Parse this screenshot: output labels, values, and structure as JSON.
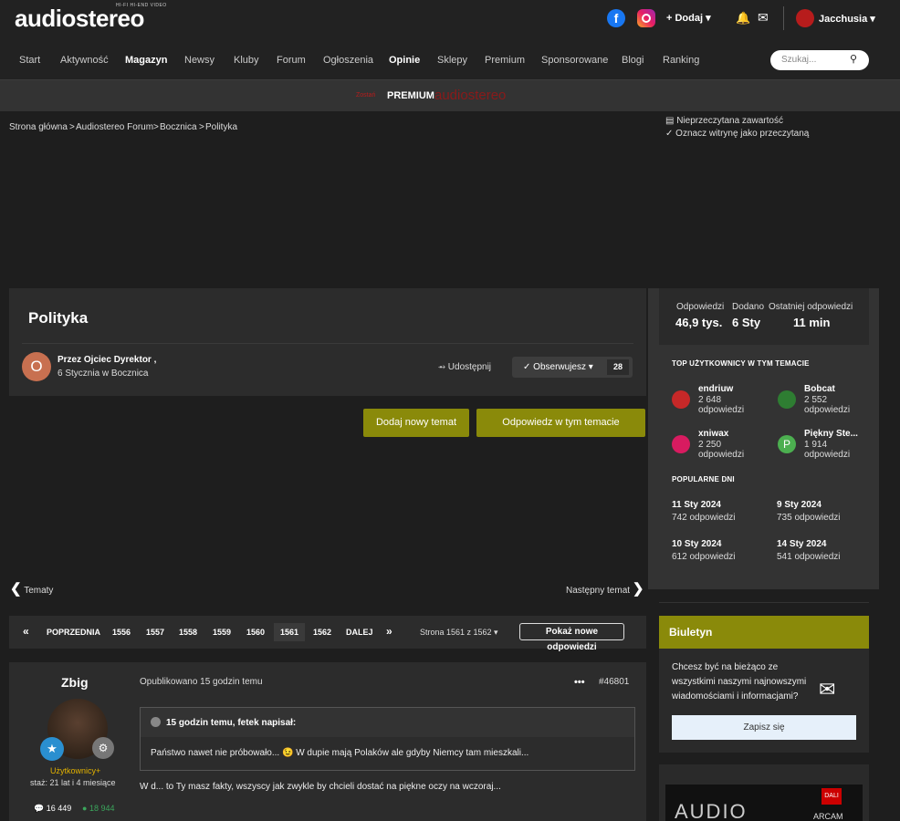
{
  "header": {
    "logo": "audiostereo",
    "logo_sub": "HI-FI   HI-END   VIDEO",
    "add_label": "+ Dodaj ▾",
    "user_name": "Jacchusia ▾"
  },
  "nav": [
    {
      "label": "Start"
    },
    {
      "label": "Aktywność"
    },
    {
      "label": "Magazyn"
    },
    {
      "label": "Newsy"
    },
    {
      "label": "Kluby"
    },
    {
      "label": "Forum"
    },
    {
      "label": "Ogłoszenia"
    },
    {
      "label": "Opinie"
    },
    {
      "label": "Sklepy"
    },
    {
      "label": "Premium"
    },
    {
      "label": "Sponsorowane"
    },
    {
      "label": "Blogi"
    },
    {
      "label": "Ranking"
    }
  ],
  "search": {
    "placeholder": "Szukaj..."
  },
  "strip": {
    "t1": "Zostań",
    "t2": "PREMIUM",
    "t3": "audiostereo"
  },
  "breadcrumb": [
    "Strona główna",
    "Audiostereo Forum",
    "Bocznica",
    "Polityka"
  ],
  "unread": "Nieprzeczytana zawartość",
  "markread": "Oznacz witrynę jako przeczytaną",
  "topic": {
    "title": "Polityka",
    "author_initial": "O",
    "by": "Przez Ojciec Dyrektor ,",
    "date": "6 Stycznia w Bocznica",
    "share": "Udostępnij",
    "follow": "Obserwujesz ▾",
    "follow_count": "28",
    "new_topic": "Dodaj nowy temat",
    "reply": "Odpowiedz w tym temacie",
    "prev": "Tematy",
    "next": "Następny temat"
  },
  "pagination": {
    "prev": "POPRZEDNIA",
    "pages": [
      "1556",
      "1557",
      "1558",
      "1559",
      "1560",
      "1561",
      "1562"
    ],
    "current": "1561",
    "next": "DALEJ",
    "of": "Strona 1561 z 1562 ▾",
    "new": "Pokaż nowe odpowiedzi"
  },
  "post": {
    "author": "Zbig",
    "rank": "Użytkownicy+",
    "staz": "staż: 21 lat i 4 miesiące",
    "posts": "16 449",
    "rep": "18 944",
    "time": "Opublikowano 15 godzin temu",
    "dots": "•••",
    "id": "#46801",
    "quote_head": "15 godzin temu, fetek napisał:",
    "quote_text": "Państwo nawet nie próbowało... 😉 W dupie mają Polaków ale gdyby Niemcy tam mieszkali...",
    "text": "W d... to Ty masz fakty, wszyscy jak zwykle by chcieli dostać na piękne oczy na wczoraj..."
  },
  "stats": {
    "replies_label": "Odpowiedzi",
    "replies": "46,9 tys.",
    "added_label": "Dodano",
    "added": "6 Sty",
    "last_label": "Ostatniej odpowiedzi",
    "last": "11 min"
  },
  "top_users": {
    "heading": "TOP UŻYTKOWNICY W TYM TEMACIE",
    "items": [
      {
        "name": "endriuw",
        "count": "2 648",
        "unit": "odpowiedzi",
        "color": "#c62828"
      },
      {
        "name": "Bobcat",
        "count": "2 552",
        "unit": "odpowiedzi",
        "color": "#2e7d32"
      },
      {
        "name": "xniwax",
        "count": "2 250",
        "unit": "odpowiedzi",
        "color": "#d81b60"
      },
      {
        "name": "Piękny Ste...",
        "count": "1 914",
        "unit": "odpowiedzi",
        "color": "#4caf50",
        "initial": "P"
      }
    ]
  },
  "popular_days": {
    "heading": "POPULARNE DNI",
    "items": [
      {
        "date": "11 Sty 2024",
        "count": "742 odpowiedzi"
      },
      {
        "date": "9 Sty 2024",
        "count": "735 odpowiedzi"
      },
      {
        "date": "10 Sty 2024",
        "count": "612 odpowiedzi"
      },
      {
        "date": "14 Sty 2024",
        "count": "541 odpowiedzi"
      }
    ]
  },
  "newsletter": {
    "title": "Biuletyn",
    "text": "Chcesz być na bieżąco ze wszystkimi naszymi najnowszymi wiadomościami i informacjami?",
    "button": "Zapisz się"
  },
  "ad": {
    "brand": "AUDIO",
    "dali": "DALI",
    "arcam": "ARCAM"
  }
}
